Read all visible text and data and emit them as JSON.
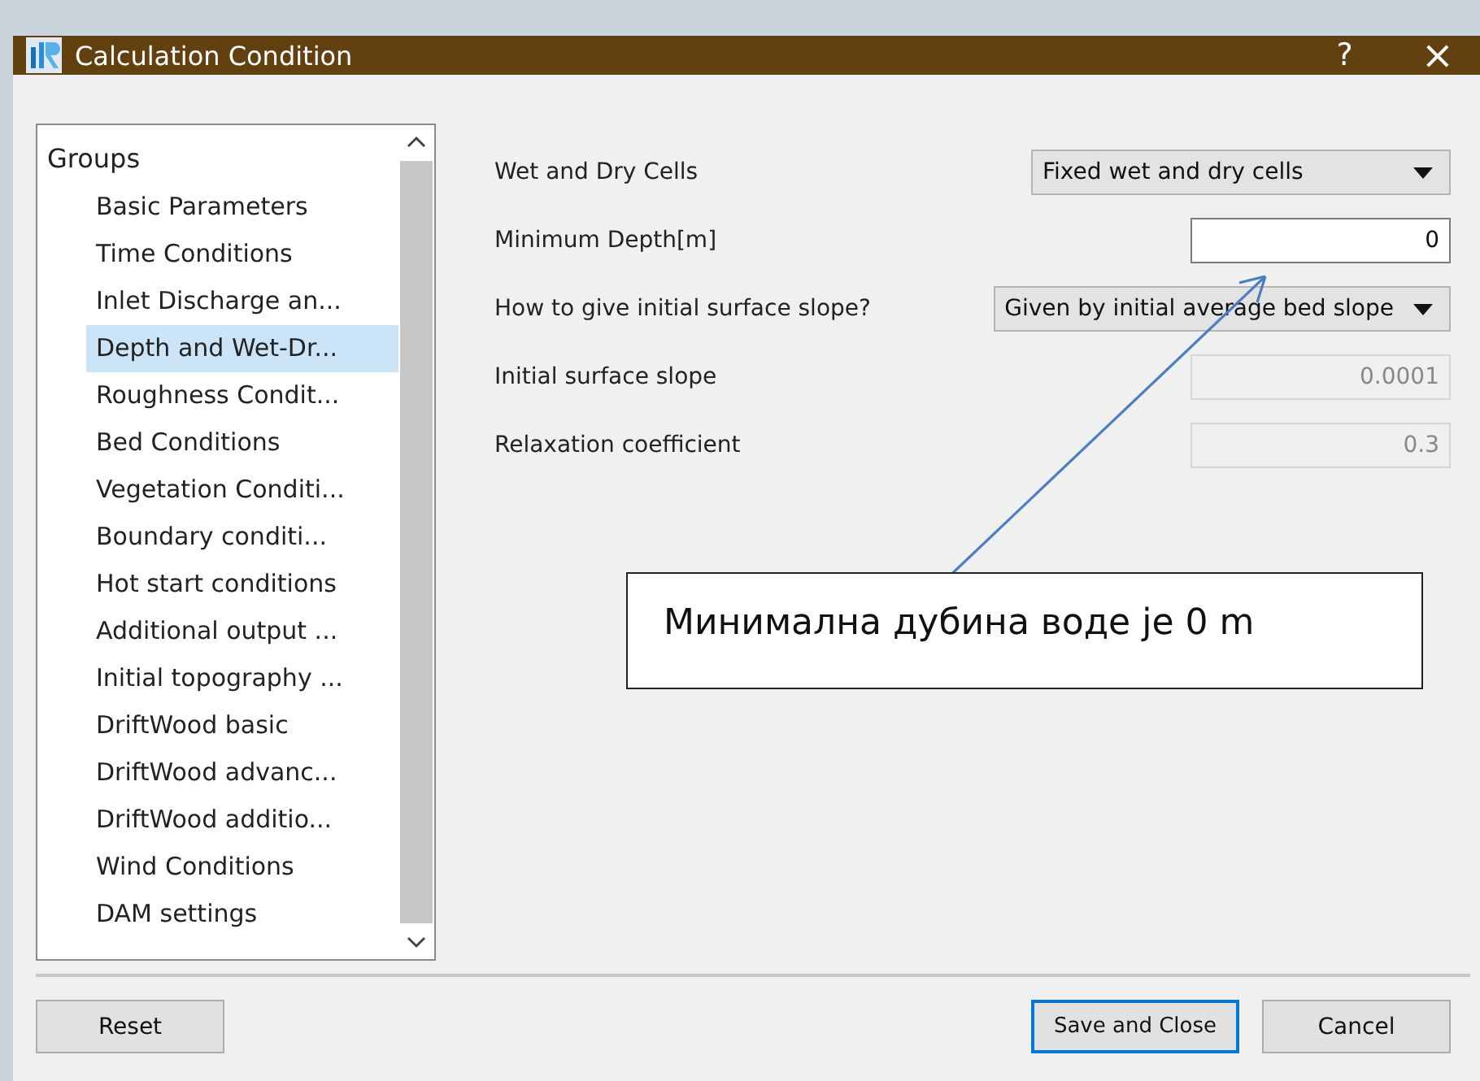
{
  "window": {
    "title": "Calculation Condition",
    "help": "?",
    "close": "×"
  },
  "tree": {
    "header": "Groups",
    "items": [
      {
        "label": "Basic Parameters",
        "selected": false
      },
      {
        "label": "Time Conditions",
        "selected": false
      },
      {
        "label": "Inlet Discharge an...",
        "selected": false
      },
      {
        "label": "Depth and Wet-Dr...",
        "selected": true
      },
      {
        "label": "Roughness Condit...",
        "selected": false
      },
      {
        "label": "Bed Conditions",
        "selected": false
      },
      {
        "label": "Vegetation Conditi...",
        "selected": false
      },
      {
        "label": "Boundary conditi...",
        "selected": false
      },
      {
        "label": "Hot start conditions",
        "selected": false
      },
      {
        "label": "Additional output ...",
        "selected": false
      },
      {
        "label": "Initial topography ...",
        "selected": false
      },
      {
        "label": "DriftWood basic",
        "selected": false
      },
      {
        "label": "DriftWood advanc...",
        "selected": false
      },
      {
        "label": "DriftWood additio...",
        "selected": false
      },
      {
        "label": "Wind Conditions",
        "selected": false
      },
      {
        "label": "DAM settings",
        "selected": false
      }
    ]
  },
  "fields": [
    {
      "kind": "dropdown",
      "label": "Wet and Dry Cells",
      "value": "Fixed wet and dry cells"
    },
    {
      "kind": "input",
      "label": "Minimum Depth[m]",
      "value": "0",
      "disabled": false
    },
    {
      "kind": "dropdown",
      "label": "How to give initial surface slope?",
      "value": "Given by initial average bed slope"
    },
    {
      "kind": "input",
      "label": "Initial surface slope",
      "value": "0.0001",
      "disabled": true
    },
    {
      "kind": "input",
      "label": "Relaxation coefficient",
      "value": "0.3",
      "disabled": true
    }
  ],
  "callout": {
    "text": "Минимална дубина воде је 0 m"
  },
  "buttons": [
    {
      "label": "Reset",
      "focused": false
    },
    {
      "label": "Save and Close",
      "focused": true
    },
    {
      "label": "Cancel",
      "focused": false
    }
  ]
}
